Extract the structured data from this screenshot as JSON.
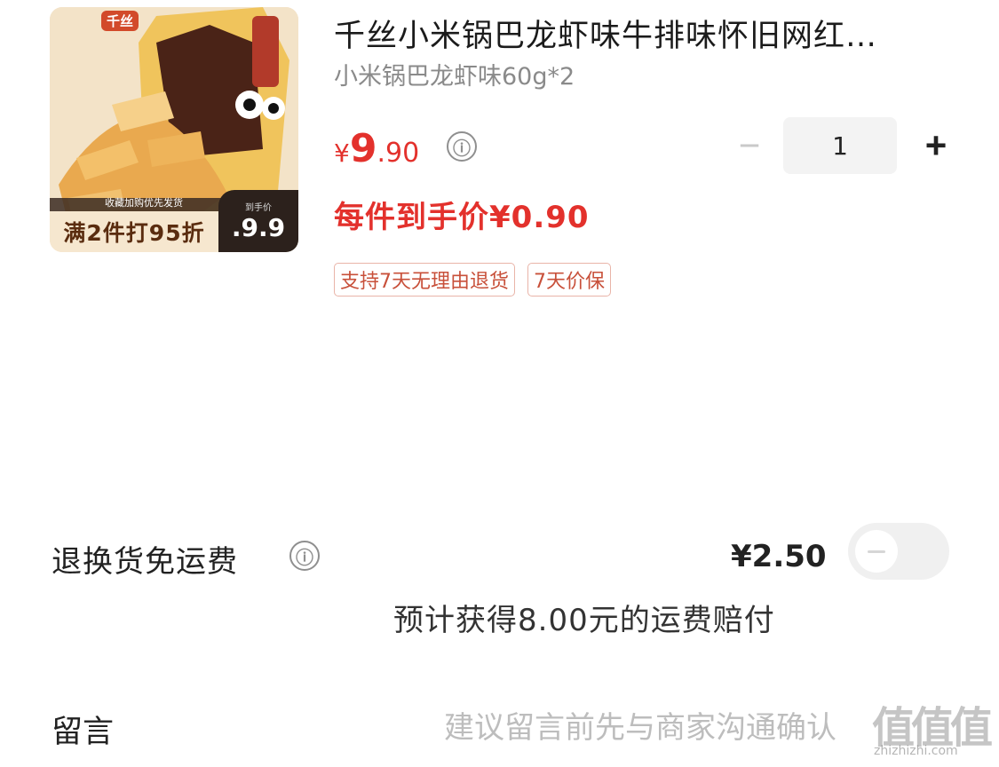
{
  "product": {
    "image_logo_text": "千丝",
    "promo_left": "满2件打95折",
    "promo_small": "收藏加购优先发货",
    "promo_right_label": "到手价",
    "promo_right_price": ".9.9",
    "title": "千丝小米锅巴龙虾味牛排味怀旧网红…",
    "spec": "小米锅巴龙虾味60g*2",
    "price_currency": "¥",
    "price_integer": "9",
    "price_decimal": ".90",
    "per_unit_price": "每件到手价¥0.90",
    "tags": [
      "支持7天无理由退货",
      "7天价保"
    ],
    "quantity": "1",
    "minus_label": "−",
    "plus_label": "+",
    "info_icon": "ⓘ"
  },
  "shipping_return": {
    "label": "退换货免运费",
    "price": "¥2.50",
    "toggle_on": false,
    "compensation_text": "预计获得8.00元的运费赔付"
  },
  "message": {
    "label": "留言",
    "placeholder": "建议留言前先与商家沟通确认"
  },
  "watermark": {
    "glyphs": "值值值",
    "url": "zhizhizhi.com"
  },
  "colors": {
    "price_red": "#e3312c",
    "tag_border": "#e9b4a8",
    "toggle_off": "#f0f0f0"
  }
}
